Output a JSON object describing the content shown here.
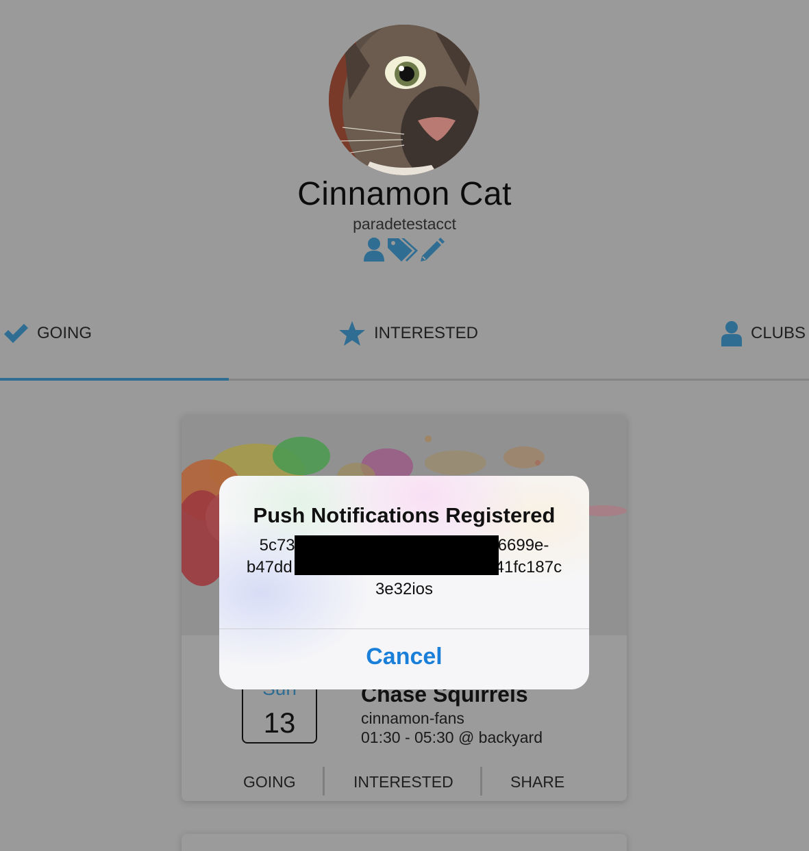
{
  "profile": {
    "name": "Cinnamon Cat",
    "handle": "paradetestacct",
    "actions": [
      {
        "icon": "user-icon"
      },
      {
        "icon": "tags-icon"
      },
      {
        "icon": "pencil-icon"
      }
    ]
  },
  "tabs": [
    {
      "label": "GOING",
      "icon": "check-icon",
      "active": true
    },
    {
      "label": "INTERESTED",
      "icon": "star-icon",
      "active": false
    },
    {
      "label": "CLUBS",
      "icon": "user-icon",
      "active": false
    }
  ],
  "event": {
    "day": "Sun",
    "date": "13",
    "title": "Chase Squirrels",
    "club": "cinnamon-fans",
    "time": "01:30 - 05:30 @ backyard",
    "actions": {
      "going": "GOING",
      "interested": "INTERESTED",
      "share": "SHARE"
    }
  },
  "alert": {
    "title": "Push Notifications Registered",
    "message_lines": [
      "5c73",
      "6699e-",
      "b47dd",
      "41fc187c",
      "3e32ios"
    ],
    "cancel_label": "Cancel"
  },
  "colors": {
    "accent": "#2f6d92",
    "dim_background": "#9a9a9a",
    "alert_button": "#1a7fd9"
  }
}
